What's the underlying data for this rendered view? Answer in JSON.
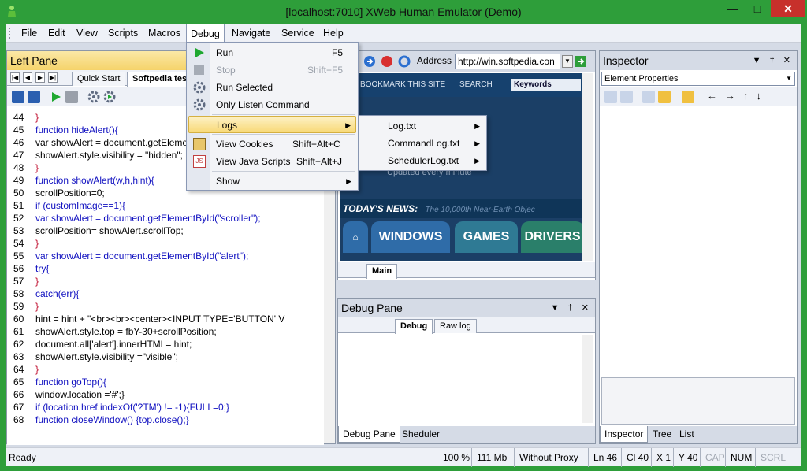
{
  "window": {
    "title": "[localhost:7010] XWeb Human Emulator (Demo)"
  },
  "menu": [
    "File",
    "Edit",
    "View",
    "Scripts",
    "Macros",
    "Debug",
    "Navigate",
    "Service",
    "Help"
  ],
  "debug_menu": {
    "items": [
      {
        "label": "Run",
        "shortcut": "F5",
        "icon": "play-icon"
      },
      {
        "label": "Stop",
        "shortcut": "Shift+F5",
        "icon": "stop-icon",
        "disabled": true
      },
      {
        "label": "Run Selected",
        "shortcut": "",
        "icon": "gear-icon"
      },
      {
        "label": "Only Listen Command",
        "shortcut": "",
        "icon": "gear-icon"
      },
      {
        "label": "Logs",
        "shortcut": "",
        "submenu": true
      },
      {
        "label": "View Cookies",
        "shortcut": "Shift+Alt+C",
        "icon": "cookie-icon"
      },
      {
        "label": "View Java Scripts",
        "shortcut": "Shift+Alt+J",
        "icon": "script-icon"
      },
      {
        "label": "Show",
        "shortcut": "",
        "submenu": true
      }
    ]
  },
  "logs_submenu": [
    "Log.txt",
    "CommandLog.txt",
    "SchedulerLog.txt"
  ],
  "left_pane": {
    "title": "Left Pane",
    "tabs": [
      "Quick Start",
      "Softpedia tes"
    ],
    "code": [
      {
        "n": "44",
        "t": "}"
      },
      {
        "n": "45",
        "t": "function hideAlert(){"
      },
      {
        "n": "46",
        "t": "var showAlert = document.getElementById("
      },
      {
        "n": "47",
        "t": "showAlert.style.visibility = \"hidden\";"
      },
      {
        "n": "48",
        "t": "}"
      },
      {
        "n": "49",
        "t": "function showAlert(w,h,hint){"
      },
      {
        "n": "50",
        "t": "scrollPosition=0;"
      },
      {
        "n": "51",
        "t": "if (customImage==1){"
      },
      {
        "n": "52",
        "t": "var showAlert = document.getElementById(\"scroller\");"
      },
      {
        "n": "53",
        "t": "scrollPosition= showAlert.scrollTop;"
      },
      {
        "n": "54",
        "t": "}"
      },
      {
        "n": "55",
        "t": "var showAlert = document.getElementById(\"alert\");"
      },
      {
        "n": "56",
        "t": "try{"
      },
      {
        "n": "57",
        "t": "}"
      },
      {
        "n": "58",
        "t": "catch(err){"
      },
      {
        "n": "59",
        "t": "}"
      },
      {
        "n": "60",
        "t": "hint = hint + \"<br><br><center><INPUT TYPE='BUTTON' V"
      },
      {
        "n": "61",
        "t": "showAlert.style.top = fbY-30+scrollPosition;"
      },
      {
        "n": "62",
        "t": "document.all['alert'].innerHTML= hint;"
      },
      {
        "n": "63",
        "t": "showAlert.style.visibility =\"visible\";"
      },
      {
        "n": "64",
        "t": "}"
      },
      {
        "n": "65",
        "t": "function goTop(){"
      },
      {
        "n": "66",
        "t": "window.location ='#';}"
      },
      {
        "n": "67",
        "t": "if (location.href.indexOf('?TM') != -1){FULL=0;}"
      },
      {
        "n": "68",
        "t": "function closeWindow() {top.close();}"
      }
    ]
  },
  "browser": {
    "address_label": "Address",
    "url": "http://win.softpedia.con",
    "site_top": [
      "BOOKMARK THIS SITE",
      "SEARCH",
      "Keywords"
    ],
    "site_sub": "Updated every minute",
    "news_label": "TODAY'S NEWS:",
    "news_text": "The 10,000th Near-Earth Objec",
    "site_tabs": [
      "WINDOWS",
      "GAMES",
      "DRIVERS"
    ],
    "bottom_tab": "Main"
  },
  "debug_pane": {
    "title": "Debug Pane",
    "tabs": [
      "Debug",
      "Raw log"
    ],
    "bottom_tabs": [
      "Debug Pane",
      "Sheduler"
    ]
  },
  "inspector": {
    "title": "Inspector",
    "select_value": "Element Properties",
    "bottom_tabs": [
      "Inspector",
      "Tree",
      "List"
    ]
  },
  "status": {
    "ready": "Ready",
    "zoom": "100 %",
    "mem": "111 Mb",
    "proxy": "Without Proxy",
    "ln": "Ln 46",
    "cl": "Cl 40",
    "x": "X 1",
    "y": "Y 40",
    "cap": "CAP",
    "num": "NUM",
    "scrl": "SCRL"
  },
  "colors": {
    "accent": "#2e9e3a",
    "highlight": "#f8d977",
    "site_bg": "#1b3f66"
  }
}
